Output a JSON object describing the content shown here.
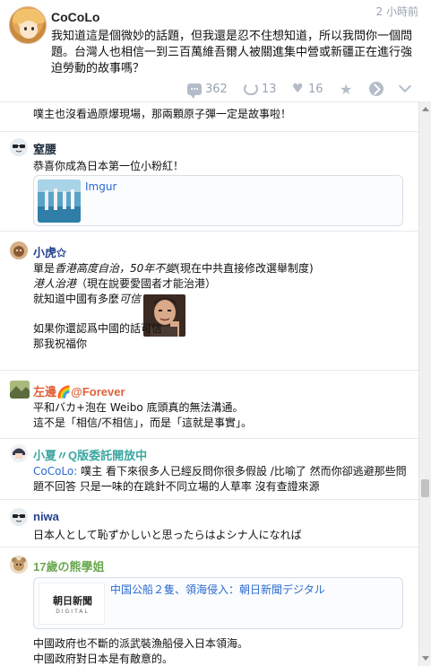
{
  "post": {
    "author": "CoCoLo",
    "time": "2 小時前",
    "body": "我知道這是個微妙的話題，但我還是忍不住想知道，所以我問你一個問題。台灣人也相信一到三百萬維吾爾人被關進集中營或新疆正在進行強迫勞動的故事嗎？",
    "stats": {
      "comments": "362",
      "reposts": "13",
      "likes": "16"
    }
  },
  "comments": [
    {
      "author": "",
      "lines": [
        "噗主也沒看過原爆現場，那兩顆原子彈一定是故事啦！"
      ]
    },
    {
      "author": "窒腰",
      "author_color": "#1f2d3d",
      "lines": [
        "恭喜你成為日本第一位小粉紅！"
      ],
      "card_title": "Imgur"
    },
    {
      "author": "小虎✩",
      "author_color": "#23408e",
      "line1_a": "單是",
      "line1_b": "香港高度自治，50年不變",
      "line1_c": "(現在中共直接修改選舉制度)",
      "line2_a": "港人治港",
      "line2_b": "（現在說要愛國者才能治港）",
      "line3_a": "就知道中國有多麼",
      "line3_b": "可信",
      "line4": "如果你還認爲中國的話可信",
      "line5": "那我祝福你"
    },
    {
      "author": "左邊🌈@Forever",
      "author_color": "#e0623a",
      "lines": [
        "平和バカ+泡在 Weibo 底頭真的無法溝通。",
        "這不是「相信/不相信」，而是「這就是事實」。"
      ]
    },
    {
      "author": "小夏〃Q版委託開放中",
      "author_color": "#3aa6a0",
      "reply_to": "CoCoLo:",
      "lines": [
        "噗主 看下來很多人已經反問你很多假設 /比喻了 然而你卻逃避那些問",
        "題不回答 只是一味的在跳針不同立場的人草率 沒有查證來源"
      ]
    },
    {
      "author": "niwa",
      "author_color": "#23408e",
      "lines": [
        "日本人として恥ずかしいと思ったらはよシナ人になれば"
      ]
    },
    {
      "author": "17歲の熊學姐",
      "author_color": "#6aa84f",
      "card_title": "中国公船２隻、領海侵入：朝日新聞デジタル",
      "card_logo_top": "朝日新聞",
      "card_logo_bottom": "DIGITAL",
      "lines": [
        "中國政府也不斷的派武裝漁船侵入日本領海。",
        "中國政府對日本是有敵意的。"
      ]
    }
  ]
}
